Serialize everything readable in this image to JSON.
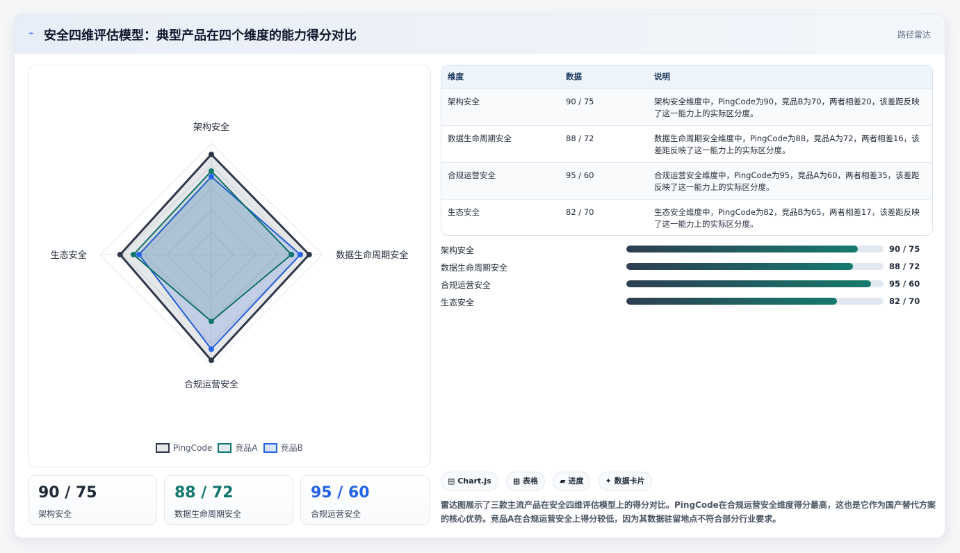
{
  "header": {
    "icon": "⌁",
    "title": "安全四维评估模型：典型产品在四个维度的能力得分对比",
    "tag": "路径雷达"
  },
  "chart_data": {
    "type": "radar",
    "axes": [
      "架构安全",
      "数据生命周期安全",
      "合规运营安全",
      "生态安全"
    ],
    "range": [
      0,
      100
    ],
    "grid": true,
    "legend_position": "bottom-center",
    "series": [
      {
        "name": "PingCode",
        "values": [
          90,
          88,
          95,
          82
        ],
        "color": "#2d3748",
        "fill": "rgba(45,55,72,0.12)"
      },
      {
        "name": "竞品A",
        "values": [
          75,
          72,
          60,
          70
        ],
        "color": "#0f766e",
        "fill": "rgba(15,118,110,0.12)"
      },
      {
        "name": "竞品B",
        "values": [
          70,
          80,
          85,
          65
        ],
        "color": "#2563eb",
        "fill": "rgba(37,99,235,0.18)"
      }
    ]
  },
  "stats": [
    {
      "value": "90 / 75",
      "label": "架构安全",
      "color": "#1f2937"
    },
    {
      "value": "88 / 72",
      "label": "数据生命周期安全",
      "color": "#0f766e"
    },
    {
      "value": "95 / 60",
      "label": "合规运营安全",
      "color": "#2563eb"
    }
  ],
  "table": {
    "headers": [
      "维度",
      "数据",
      "说明"
    ],
    "rows": [
      [
        "架构安全",
        "90 / 75",
        "架构安全维度中，PingCode为90，竞品B为70，两者相差20，该差距反映了这一能力上的实际区分度。"
      ],
      [
        "数据生命周期安全",
        "88 / 72",
        "数据生命周期安全维度中，PingCode为88，竞品A为72，两者相差16，该差距反映了这一能力上的实际区分度。"
      ],
      [
        "合规运营安全",
        "95 / 60",
        "合规运营安全维度中，PingCode为95，竞品A为60，两者相差35，该差距反映了这一能力上的实际区分度。"
      ],
      [
        "生态安全",
        "82 / 70",
        "生态安全维度中，PingCode为82，竞品B为65，两者相差17，该差距反映了这一能力上的实际区分度。"
      ]
    ]
  },
  "progress": [
    {
      "label": "架构安全",
      "value": 90,
      "text": "90 / 75"
    },
    {
      "label": "数据生命周期安全",
      "value": 88,
      "text": "88 / 72"
    },
    {
      "label": "合规运营安全",
      "value": 95,
      "text": "95 / 60"
    },
    {
      "label": "生态安全",
      "value": 82,
      "text": "82 / 70"
    }
  ],
  "chips": [
    "▤ Chart.js",
    "▦ 表格",
    "▰ 进度",
    "✦ 数据卡片"
  ],
  "description": "雷达图展示了三款主流产品在安全四维评估模型上的得分对比。PingCode在合规运营安全维度得分最高，这也是它作为国产替代方案的核心优势。竞品A在合规运营安全上得分较低，因为其数据驻留地点不符合部分行业要求。"
}
